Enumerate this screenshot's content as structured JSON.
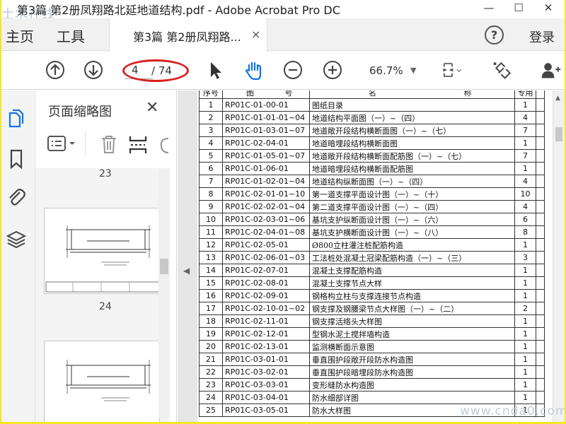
{
  "window": {
    "title": "第3篇 第2册凤翔路北延地道结构.pdf - Adobe Acrobat Pro DC",
    "watermark_top": "土木在线",
    "watermark_bottom": "www.cnda0.com"
  },
  "tabs": {
    "home": "主页",
    "tools": "工具",
    "document": "第3篇 第2册凤翔路...",
    "close": "×",
    "help": "?",
    "signin": "登录"
  },
  "toolbar": {
    "current_page": "4",
    "total_pages": "/ 74",
    "zoom": "66.7%",
    "annotation_color": "#d92020"
  },
  "thumbnails": {
    "header": "页面缩略图",
    "close": "✕",
    "pages": [
      {
        "number": "23"
      },
      {
        "number": "24"
      }
    ]
  },
  "index_table": {
    "headers": [
      "序号",
      "图",
      "号",
      "名",
      "称",
      "专用"
    ],
    "rows": [
      {
        "no": "1",
        "code": "RP01C-01-00-01",
        "name": "图纸目录",
        "count": "1"
      },
      {
        "no": "2",
        "code": "RP01C-01-01-01~04",
        "name": "地道结构平面图（一）~（四）",
        "count": "4"
      },
      {
        "no": "3",
        "code": "RP01C-01-03-01~07",
        "name": "地道敞开段结构横断面图（一）~（七）",
        "count": "7"
      },
      {
        "no": "4",
        "code": "RP01C-02-04-01",
        "name": "地道暗埋段结构横断面图",
        "count": "1"
      },
      {
        "no": "5",
        "code": "RP01C-01-05-01~07",
        "name": "地道敞开段结构横断面配筋图（一）~（七）",
        "count": "7"
      },
      {
        "no": "6",
        "code": "RP01C-01-06-01",
        "name": "地道暗埋段结构横断面配筋图",
        "count": "1"
      },
      {
        "no": "7",
        "code": "RP01C-01-02-01~04",
        "name": "地道结构纵断面图（一）~（四）",
        "count": "4"
      },
      {
        "no": "8",
        "code": "RP01C-02-01-01~10",
        "name": "第一道支撑平面设计图（一）~（十）",
        "count": "10"
      },
      {
        "no": "9",
        "code": "RP01C-02-02-01~04",
        "name": "第二道支撑平面设计图（一）~（四）",
        "count": "4"
      },
      {
        "no": "10",
        "code": "RP01C-02-03-01~06",
        "name": "基坑支护纵断面设计图（一）~（六）",
        "count": "6"
      },
      {
        "no": "11",
        "code": "RP01C-02-04-01~08",
        "name": "基坑支护横断面设计图（一）~（八）",
        "count": "8"
      },
      {
        "no": "12",
        "code": "RP01C-02-05-01",
        "name": "Ø800立柱灌注桩配筋构造",
        "count": "1"
      },
      {
        "no": "13",
        "code": "RP01C-02-06-01~03",
        "name": "工法桩处混凝土冠梁配筋构造（一）~（三）",
        "count": "3"
      },
      {
        "no": "14",
        "code": "RP01C-02-07-01",
        "name": "混凝土支撑配筋构造",
        "count": "1"
      },
      {
        "no": "15",
        "code": "RP01C-02-08-01",
        "name": "混凝土支撑节点大样",
        "count": "1"
      },
      {
        "no": "16",
        "code": "RP01C-02-09-01",
        "name": "钢格构立柱与支撑连接节点构造",
        "count": "1"
      },
      {
        "no": "17",
        "code": "RP01C-02-10-01~02",
        "name": "钢支撑及钢腰梁节点大样图（一）~（二）",
        "count": "2"
      },
      {
        "no": "18",
        "code": "RP01C-02-11-01",
        "name": "钢支撑活络头大样图",
        "count": "1"
      },
      {
        "no": "19",
        "code": "RP01C-02-12-01",
        "name": "型钢水泥土搅拌墙构造",
        "count": "1"
      },
      {
        "no": "20",
        "code": "RP01C-02-13-01",
        "name": "监测横断面示意图",
        "count": "1"
      },
      {
        "no": "21",
        "code": "RP01C-03-01-01",
        "name": "垂直围护段敞开段防水构造图",
        "count": "1"
      },
      {
        "no": "22",
        "code": "RP01C-03-02-01",
        "name": "垂直围护段暗埋段防水构造图",
        "count": "1"
      },
      {
        "no": "23",
        "code": "RP01C-03-03-01",
        "name": "变形缝防水构造图",
        "count": "1"
      },
      {
        "no": "24",
        "code": "RP01C-03-04-01",
        "name": "防水细部详图",
        "count": "1"
      },
      {
        "no": "25",
        "code": "RP01C-03-05-01",
        "name": "防水大样图",
        "count": "1"
      }
    ]
  }
}
